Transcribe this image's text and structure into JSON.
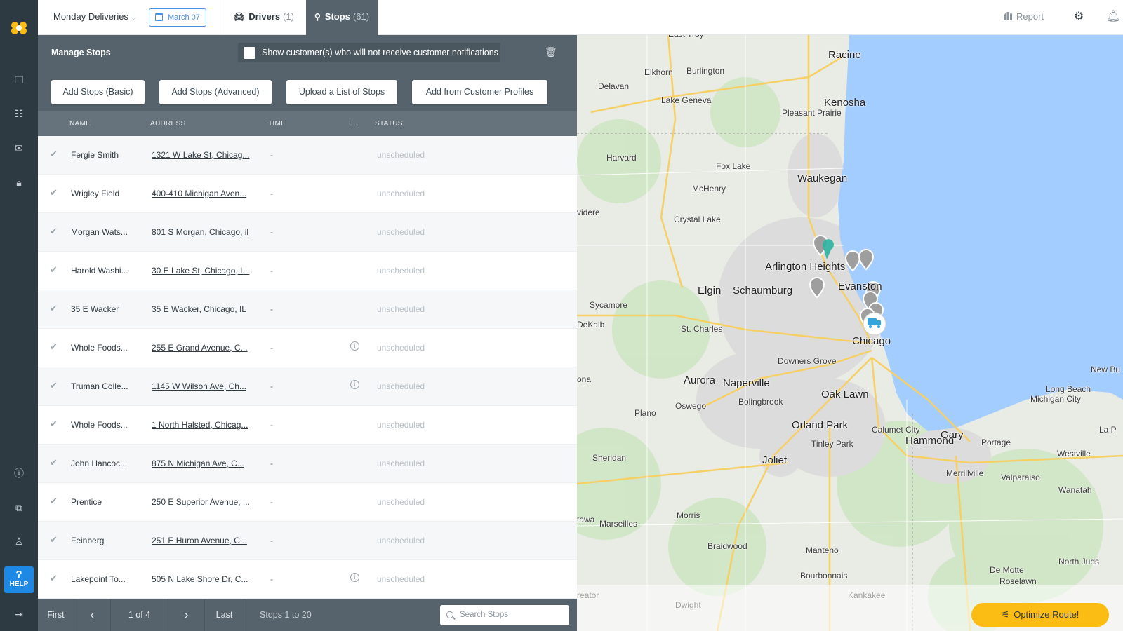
{
  "app": {
    "route_name": "Monday Deliveries",
    "date": "March 07",
    "tabs": [
      {
        "label": "Drivers",
        "count": "(1)"
      },
      {
        "label": "Stops",
        "count": "(61)"
      }
    ],
    "report_label": "Report"
  },
  "nav": {
    "help_mark": "?",
    "help_label": "HELP"
  },
  "manage": {
    "title": "Manage Stops",
    "notify_label": "Show customer(s) who will not receive customer notifications",
    "buttons": [
      "Add Stops (Basic)",
      "Add Stops (Advanced)",
      "Upload a List of Stops",
      "Add from Customer Profiles"
    ]
  },
  "table": {
    "columns": [
      "NAME",
      "ADDRESS",
      "TIME",
      "I...",
      "STATUS"
    ],
    "rows": [
      {
        "name": "Fergie Smith",
        "address": "1321 W Lake St, Chicag...",
        "time": "-",
        "info": false,
        "status": "unscheduled"
      },
      {
        "name": "Wrigley Field",
        "address": "400-410 Michigan Aven...",
        "time": "-",
        "info": false,
        "status": "unscheduled"
      },
      {
        "name": "Morgan Wats...",
        "address": "801 S Morgan, Chicago, il",
        "time": "-",
        "info": false,
        "status": "unscheduled"
      },
      {
        "name": "Harold Washi...",
        "address": "30 E Lake St, Chicago, I...",
        "time": "-",
        "info": false,
        "status": "unscheduled"
      },
      {
        "name": "35 E Wacker",
        "address": "35 E Wacker, Chicago, IL",
        "time": "-",
        "info": false,
        "status": "unscheduled"
      },
      {
        "name": "Whole Foods...",
        "address": "255 E Grand Avenue, C...",
        "time": "-",
        "info": true,
        "status": "unscheduled"
      },
      {
        "name": "Truman Colle...",
        "address": "1145 W Wilson Ave, Ch...",
        "time": "-",
        "info": true,
        "status": "unscheduled"
      },
      {
        "name": "Whole Foods...",
        "address": "1 North Halsted, Chicag...",
        "time": "-",
        "info": false,
        "status": "unscheduled"
      },
      {
        "name": "John Hancoc...",
        "address": "875 N Michigan Ave, C...",
        "time": "-",
        "info": false,
        "status": "unscheduled"
      },
      {
        "name": "Prentice",
        "address": "250 E Superior Avenue, ...",
        "time": "-",
        "info": false,
        "status": "unscheduled"
      },
      {
        "name": "Feinberg",
        "address": "251 E Huron Avenue, C...",
        "time": "-",
        "info": false,
        "status": "unscheduled"
      },
      {
        "name": "Lakepoint To...",
        "address": "505 N Lake Shore Dr, C...",
        "time": "-",
        "info": true,
        "status": "unscheduled"
      }
    ]
  },
  "pager": {
    "first": "First",
    "prev": "‹",
    "page": "1 of 4",
    "next": "›",
    "last": "Last",
    "range": "Stops 1 to 20",
    "search_placeholder": "Search Stops"
  },
  "map": {
    "labels": [
      {
        "name": "East Troy"
      },
      {
        "name": "Racine"
      },
      {
        "name": "Elkhorn"
      },
      {
        "name": "Burlington"
      },
      {
        "name": "Delavan"
      },
      {
        "name": "Lake Geneva"
      },
      {
        "name": "Kenosha"
      },
      {
        "name": "Pleasant Prairie"
      },
      {
        "name": "Harvard"
      },
      {
        "name": "Fox Lake"
      },
      {
        "name": "Waukegan"
      },
      {
        "name": "McHenry"
      },
      {
        "name": "videre"
      },
      {
        "name": "Crystal Lake"
      },
      {
        "name": "Arlington Heights"
      },
      {
        "name": "Elgin"
      },
      {
        "name": "Schaumburg"
      },
      {
        "name": "Evanston"
      },
      {
        "name": "Sycamore"
      },
      {
        "name": "DeKalb"
      },
      {
        "name": "St. Charles"
      },
      {
        "name": "Chicago"
      },
      {
        "name": "Downers Grove"
      },
      {
        "name": "Aurora"
      },
      {
        "name": "Naperville"
      },
      {
        "name": "Oswego"
      },
      {
        "name": "Bolingbrook"
      },
      {
        "name": "Oak Lawn"
      },
      {
        "name": "ona"
      },
      {
        "name": "New Bu"
      },
      {
        "name": "Long Beach"
      },
      {
        "name": "Michigan City"
      },
      {
        "name": "Plano"
      },
      {
        "name": "Orland Park"
      },
      {
        "name": "Calumet City"
      },
      {
        "name": "Hammond"
      },
      {
        "name": "Gary"
      },
      {
        "name": "Portage"
      },
      {
        "name": "La P"
      },
      {
        "name": "Tinley Park"
      },
      {
        "name": "Sheridan"
      },
      {
        "name": "Joliet"
      },
      {
        "name": "Westville"
      },
      {
        "name": "Merrillville"
      },
      {
        "name": "Valparaiso"
      },
      {
        "name": "Wanatah"
      },
      {
        "name": "tawa"
      },
      {
        "name": "Marseilles"
      },
      {
        "name": "Morris"
      },
      {
        "name": "Braidwood"
      },
      {
        "name": "Manteno"
      },
      {
        "name": "De Motte"
      },
      {
        "name": "North Juds"
      },
      {
        "name": "Bourbonnais"
      },
      {
        "name": "Roselawn"
      },
      {
        "name": "Kankakee"
      },
      {
        "name": "Dwight"
      },
      {
        "name": "reator"
      }
    ]
  },
  "optimize_label": "Optimize Route!",
  "colors": {
    "accent": "#4a90e2",
    "panel": "#56636c",
    "optimize": "#fbbc13",
    "lake": "#a3ccff"
  }
}
